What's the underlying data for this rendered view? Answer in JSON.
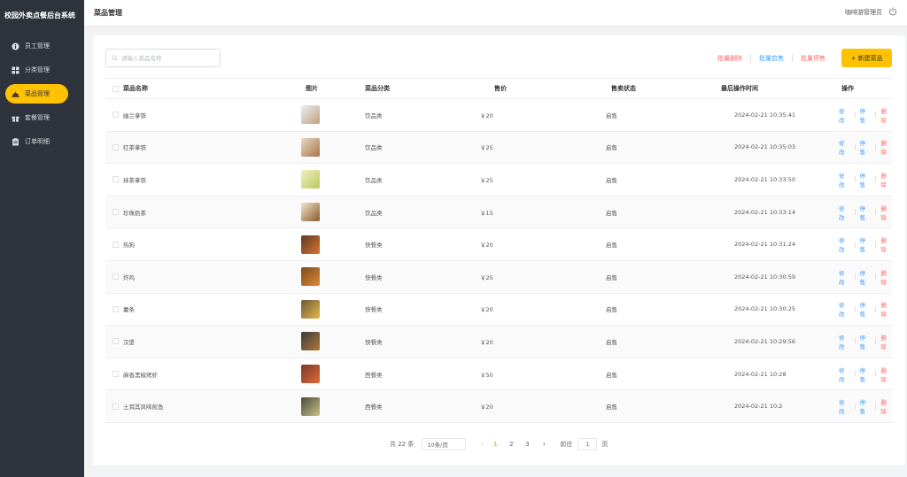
{
  "app": {
    "title": "校园外卖点餐后台系统"
  },
  "sidebar": {
    "items": [
      {
        "label": "员工管理",
        "icon": "user-icon"
      },
      {
        "label": "分类管理",
        "icon": "grid-icon"
      },
      {
        "label": "菜品管理",
        "icon": "dish-icon",
        "active": true
      },
      {
        "label": "套餐管理",
        "icon": "gift-icon"
      },
      {
        "label": "订单明细",
        "icon": "clipboard-icon"
      }
    ]
  },
  "header": {
    "title": "菜品管理",
    "user": "咖啡游管理员"
  },
  "search": {
    "placeholder": "请输入菜品名称",
    "value": ""
  },
  "toolbar": {
    "batch_delete": "批量删除",
    "batch_enable": "批量启售",
    "batch_disable": "批量停售",
    "new_button": "+ 新建菜品"
  },
  "table": {
    "headers": {
      "name": "菜品名称",
      "image": "图片",
      "category": "菜品分类",
      "price": "售价",
      "status": "售卖状态",
      "time": "最后操作时间",
      "ops": "操作"
    },
    "op_labels": {
      "edit": "修改",
      "disable": "停售",
      "delete": "删除"
    },
    "rows": [
      {
        "name": "幽兰拿铁",
        "category": "饮品类",
        "price": "￥20",
        "status": "启售",
        "time": "2024-02-21 10:35:41"
      },
      {
        "name": "红茶拿铁",
        "category": "饮品类",
        "price": "￥25",
        "status": "启售",
        "time": "2024-02-21 10:35:03"
      },
      {
        "name": "抹茶拿铁",
        "category": "饮品类",
        "price": "￥25",
        "status": "启售",
        "time": "2024-02-21 10:33:50"
      },
      {
        "name": "珍珠奶茶",
        "category": "饮品类",
        "price": "￥15",
        "status": "启售",
        "time": "2024-02-21 10:33:14"
      },
      {
        "name": "热狗",
        "category": "快餐类",
        "price": "￥20",
        "status": "启售",
        "time": "2024-02-21 10:31:24"
      },
      {
        "name": "炸鸡",
        "category": "快餐类",
        "price": "￥25",
        "status": "启售",
        "time": "2024-02-21 10:30:59"
      },
      {
        "name": "薯条",
        "category": "快餐类",
        "price": "￥20",
        "status": "启售",
        "time": "2024-02-21 10:30:25"
      },
      {
        "name": "汉堡",
        "category": "快餐类",
        "price": "￥20",
        "status": "启售",
        "time": "2024-02-21 10:29:56"
      },
      {
        "name": "麻香黑椒烤虾",
        "category": "西餐类",
        "price": "￥50",
        "status": "启售",
        "time": "2024-02-21 10:28"
      },
      {
        "name": "土耳其风味煎鱼",
        "category": "西餐类",
        "price": "￥20",
        "status": "启售",
        "time": "2024-02-21 10:2"
      }
    ]
  },
  "pagination": {
    "total": "共 22 条",
    "page_size": "10条/页",
    "pages": [
      "1",
      "2",
      "3"
    ],
    "current": "1",
    "goto_label": "前往",
    "goto_value": "1",
    "goto_suffix": "页"
  },
  "colors": {
    "accent": "#ffc200",
    "sidebar": "#2f333d",
    "danger": "#f56c6c",
    "link": "#419eff"
  }
}
